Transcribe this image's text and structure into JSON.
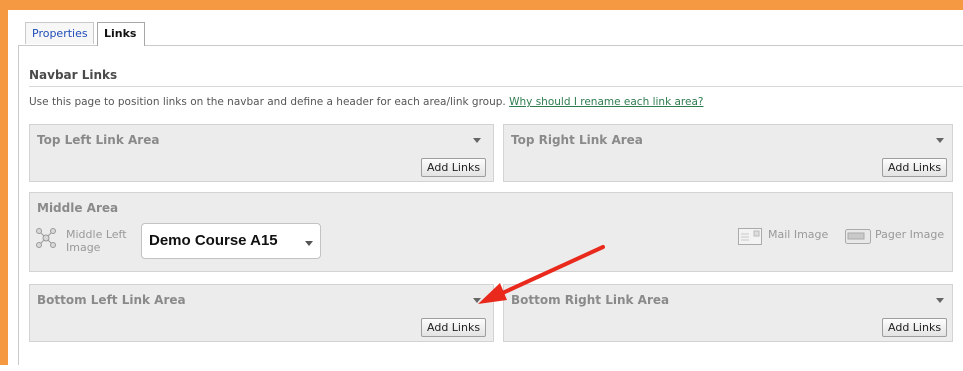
{
  "tabs": {
    "properties": "Properties",
    "links": "Links"
  },
  "section": {
    "title": "Navbar Links",
    "description": "Use this page to position links on the navbar and define a header for each area/link group.",
    "help_link": "Why should I rename each link area?"
  },
  "areas": {
    "top_left": {
      "title": "Top Left Link Area",
      "button": "Add Links"
    },
    "top_right": {
      "title": "Top Right Link Area",
      "button": "Add Links"
    },
    "middle": {
      "title": "Middle Area",
      "left_image_label_line1": "Middle Left",
      "left_image_label_line2": "Image",
      "course_select_value": "Demo Course A15",
      "mail_image_label": "Mail Image",
      "pager_image_label": "Pager Image"
    },
    "bottom_left": {
      "title": "Bottom Left Link Area",
      "button": "Add Links"
    },
    "bottom_right": {
      "title": "Bottom Right Link Area",
      "button": "Add Links"
    }
  },
  "colors": {
    "frame": "#f59a42",
    "annotation_arrow": "#e8291c",
    "link": "#2e7d4f",
    "tab_link": "#1f4db8"
  },
  "icons": [
    "dropdown-arrow-icon",
    "network-icon",
    "mail-icon",
    "pager-icon",
    "annotation-arrow"
  ]
}
